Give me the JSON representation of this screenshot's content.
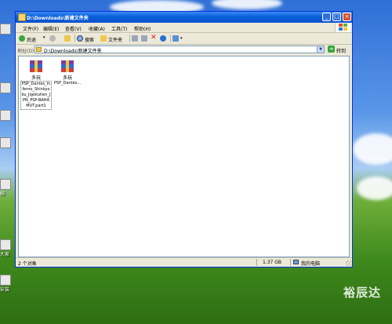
{
  "window": {
    "title": "D:\\Downloads\\新建文件夹",
    "menu": [
      "文件(F)",
      "编辑(E)",
      "查看(V)",
      "收藏(A)",
      "工具(T)",
      "帮助(H)"
    ],
    "toolbar": {
      "back": "后退",
      "search": "搜索",
      "folders": "文件夹"
    },
    "address": {
      "label": "地址(D)",
      "value": "D:\\Downloads\\新建文件夹",
      "go": "转到"
    },
    "files": [
      {
        "title": "多玩",
        "name": "PSP_Dantes_Inferno_Shinkyoku_Jigokuhen_JPN_PSP-BAHAMUT.part1",
        "selected": true
      },
      {
        "title": "多玩",
        "name": "PSP_Dantes...",
        "selected": false
      }
    ],
    "status": {
      "objects": "2 个对象",
      "size": "1.37 GB",
      "location": "我的电脑"
    }
  },
  "desktop": {
    "labels": [
      "档",
      "大家",
      "安装"
    ]
  },
  "watermark": "裕辰达",
  "colors": {
    "titlebar": "#0a5fd8",
    "chrome": "#ece9d8",
    "close": "#d9512c"
  }
}
